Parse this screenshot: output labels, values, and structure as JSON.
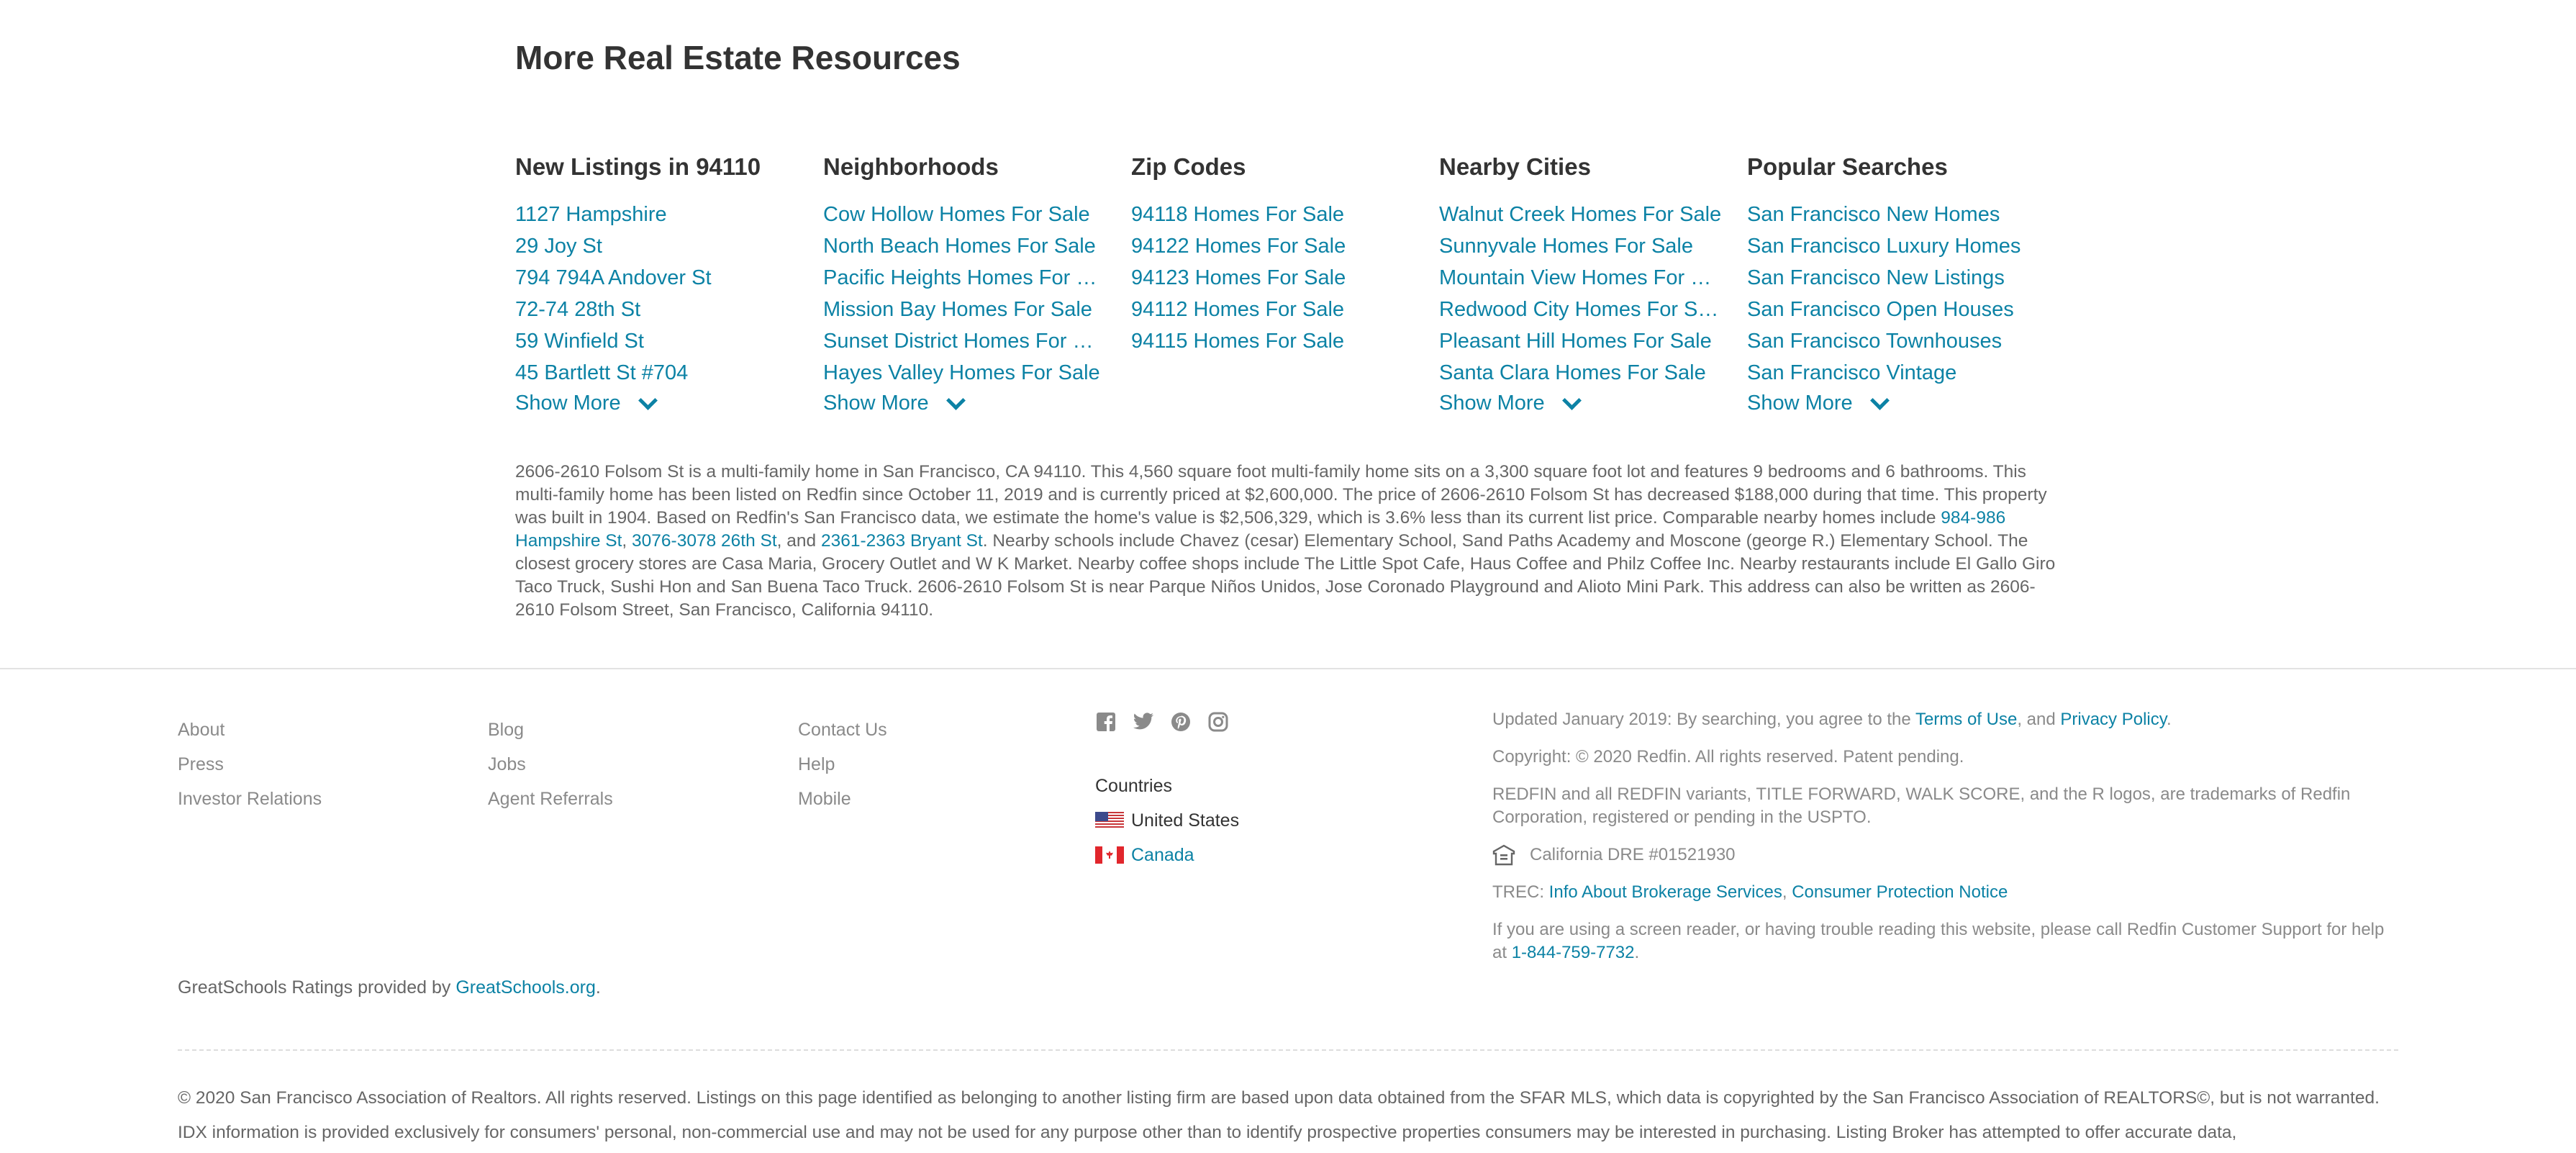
{
  "resources": {
    "title": "More Real Estate Resources",
    "columns": [
      {
        "heading": "New Listings in 94110",
        "items": [
          "1127 Hampshire",
          "29 Joy St",
          "794 794A Andover St",
          "72-74 28th St",
          "59 Winfield St",
          "45 Bartlett St #704"
        ],
        "show_more": "Show More"
      },
      {
        "heading": "Neighborhoods",
        "items": [
          "Cow Hollow Homes For Sale",
          "North Beach Homes For Sale",
          "Pacific Heights Homes For …",
          "Mission Bay Homes For Sale",
          "Sunset District Homes For …",
          "Hayes Valley Homes For Sale"
        ],
        "show_more": "Show More"
      },
      {
        "heading": "Zip Codes",
        "items": [
          "94118 Homes For Sale",
          "94122 Homes For Sale",
          "94123 Homes For Sale",
          "94112 Homes For Sale",
          "94115 Homes For Sale"
        ],
        "show_more": ""
      },
      {
        "heading": "Nearby Cities",
        "items": [
          "Walnut Creek Homes For Sale",
          "Sunnyvale Homes For Sale",
          "Mountain View Homes For …",
          "Redwood City Homes For S…",
          "Pleasant Hill Homes For Sale",
          "Santa Clara Homes For Sale"
        ],
        "show_more": "Show More"
      },
      {
        "heading": "Popular Searches",
        "items": [
          "San Francisco New Homes",
          "San Francisco Luxury Homes",
          "San Francisco New Listings",
          "San Francisco Open Houses",
          "San Francisco Townhouses",
          "San Francisco Vintage"
        ],
        "show_more": "Show More"
      }
    ]
  },
  "description": {
    "part1": "2606-2610 Folsom St is a multi-family home in San Francisco, CA 94110. This 4,560 square foot multi-family home sits on a 3,300 square foot lot and features 9 bedrooms and 6 bathrooms. This multi-family home has been listed on Redfin since October 11, 2019 and is currently priced at $2,600,000. The price of 2606-2610 Folsom St has decreased $188,000 during that time. This property was built in 1904. Based on Redfin's San Francisco data, we estimate the home's value is $2,506,329, which is 3.6% less than its current list price. Comparable nearby homes include ",
    "link1": "984-986 Hampshire St",
    "sep1": ", ",
    "link2": "3076-3078 26th St",
    "sep2": ", and ",
    "link3": "2361-2363 Bryant St",
    "part2": ". Nearby schools include Chavez (cesar) Elementary School, Sand Paths Academy and Moscone (george R.) Elementary School. The closest grocery stores are Casa Maria, Grocery Outlet and W K Market. Nearby coffee shops include The Little Spot Cafe, Haus Coffee and Philz Coffee Inc. Nearby restaurants include El Gallo Giro Taco Truck, Sushi Hon and San Buena Taco Truck. 2606-2610 Folsom St is near Parque Niños Unidos, Jose Coronado Playground and Alioto Mini Park. This address can also be written as 2606-2610 Folsom Street, San Francisco, California 94110."
  },
  "footer": {
    "col1": [
      "About",
      "Press",
      "Investor Relations"
    ],
    "col2": [
      "Blog",
      "Jobs",
      "Agent Referrals"
    ],
    "col3": [
      "Contact Us",
      "Help",
      "Mobile"
    ],
    "social_icons": [
      "facebook-icon",
      "twitter-icon",
      "pinterest-icon",
      "instagram-icon"
    ],
    "countries": {
      "title": "Countries",
      "us": "United States",
      "canada": "Canada"
    },
    "legal": {
      "updated_prefix": "Updated January 2019: By searching, you agree to the ",
      "terms": "Terms of Use",
      "and": ", and ",
      "privacy": "Privacy Policy",
      "period": ".",
      "copyright": "Copyright: © 2020 Redfin. All rights reserved. Patent pending.",
      "trademarks": "REDFIN and all REDFIN variants, TITLE FORWARD, WALK SCORE, and the R logos, are trademarks of Redfin Corporation, registered or pending in the USPTO.",
      "dre": "California DRE #01521930",
      "trec_prefix": "TREC: ",
      "trec_link1": "Info About Brokerage Services",
      "trec_sep": ", ",
      "trec_link2": "Consumer Protection Notice",
      "screen_reader": "If you are using a screen reader, or having trouble reading this website, please call Redfin Customer Support for help at ",
      "phone": "1-844-759-7732",
      "phone_end": "."
    },
    "greatschools_prefix": "GreatSchools Ratings provided by ",
    "greatschools_link": "GreatSchools.org",
    "greatschools_end": ".",
    "sfar": "© 2020 San Francisco Association of Realtors. All rights reserved. Listings on this page identified as belonging to another listing firm are based upon data obtained from the SFAR MLS, which data is copyrighted by the San Francisco Association of REALTORS©, but is not warranted. IDX information is provided exclusively for consumers' personal, non-commercial use and may not be used for any purpose other than to identify prospective properties consumers may be interested in purchasing. Listing Broker has attempted to offer accurate data,"
  },
  "colors": {
    "link": "#0c82a5",
    "heading": "#333333",
    "muted": "#8a8a8a"
  }
}
